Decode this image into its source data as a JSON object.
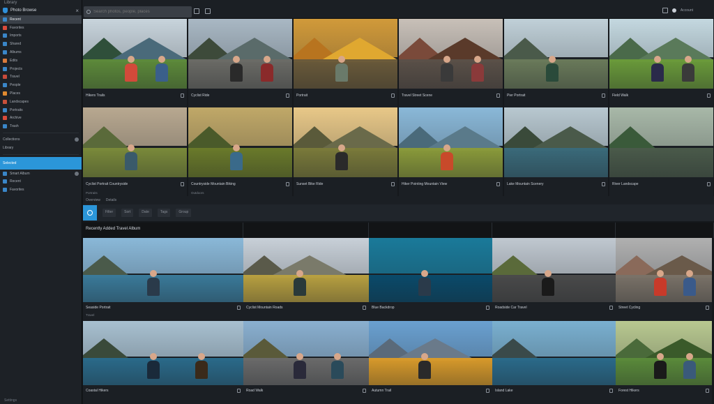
{
  "colors": {
    "accent": "#2b96d9",
    "sidebar_bg": "#1d2126",
    "panel_bg": "#1b1f24",
    "strip_bg": "#121416"
  },
  "sidebar": {
    "top_label": "Library",
    "header_title": "Photo Browse",
    "items": [
      {
        "label": "Recent",
        "icon": "folder-icon",
        "color": "#3a86c8",
        "selected": true
      },
      {
        "label": "Favorites",
        "icon": "star-icon",
        "color": "#d94b3b"
      },
      {
        "label": "Imports",
        "icon": "download-icon",
        "color": "#3a86c8"
      },
      {
        "label": "Shared",
        "icon": "share-icon",
        "color": "#3a86c8"
      },
      {
        "label": "Albums",
        "icon": "album-icon",
        "color": "#3a86c8"
      },
      {
        "label": "Edits",
        "icon": "edit-icon",
        "color": "#d97a3b"
      },
      {
        "label": "Projects",
        "icon": "folder-icon",
        "color": "#3a86c8"
      },
      {
        "label": "Travel",
        "icon": "folder-icon",
        "color": "#c84a3a"
      },
      {
        "label": "People",
        "icon": "person-icon",
        "color": "#3a86c8"
      },
      {
        "label": "Places",
        "icon": "pin-icon",
        "color": "#e08a30"
      },
      {
        "label": "Landscapes",
        "icon": "image-icon",
        "color": "#c8503a"
      },
      {
        "label": "Portraits",
        "icon": "image-icon",
        "color": "#3a86c8"
      },
      {
        "label": "Archive",
        "icon": "archive-icon",
        "color": "#d94b3b"
      },
      {
        "label": "Trash",
        "icon": "trash-icon",
        "color": "#3a86c8"
      }
    ],
    "groups_label": "Collections",
    "sub_label": "Library",
    "active_item": "Selected",
    "sub_items": [
      "Smart Album",
      "Recent",
      "Favorites"
    ],
    "bottom_label": "Settings"
  },
  "topbar": {
    "search_placeholder": "Search photos, people, places",
    "profile_label": "Account"
  },
  "top_grid": [
    {
      "title": "Hikers Trails",
      "sub": "",
      "scene": "hikers"
    },
    {
      "title": "Cyclist Ride",
      "sub": "",
      "scene": "cyclist-road"
    },
    {
      "title": "Portrait",
      "sub": "",
      "scene": "autumn-portrait"
    },
    {
      "title": "Travel Street Scene",
      "sub": "",
      "scene": "street"
    },
    {
      "title": "Pier Portrait",
      "sub": "",
      "scene": "pier"
    },
    {
      "title": "Field Walk",
      "sub": "",
      "scene": "field"
    },
    {
      "title": "Cyclist Portrait Countryside",
      "sub": "Portraits",
      "scene": "helmet-portrait"
    },
    {
      "title": "Countryside Mountain Biking",
      "sub": "Outdoors",
      "scene": "mtb"
    },
    {
      "title": "Sunset Bike Ride",
      "sub": "",
      "scene": "sunset-bike"
    },
    {
      "title": "Hiker Pointing Mountain View",
      "sub": "",
      "scene": "pointing"
    },
    {
      "title": "Lake Mountain Scenery",
      "sub": "",
      "scene": "lake"
    },
    {
      "title": "River Landscape",
      "sub": "",
      "scene": "river"
    }
  ],
  "tabs": [
    "Overview",
    "Details"
  ],
  "toolbar_chips": [
    "Filter",
    "Sort",
    "Date",
    "Tags",
    "Group"
  ],
  "strip_labels": [
    "Recently Added Travel Album",
    "",
    "",
    "",
    ""
  ],
  "bottom_grid": [
    {
      "title": "Seaside Portrait",
      "sub": "Travel",
      "scene": "coast-man"
    },
    {
      "title": "Cyclist Mountain Roads",
      "sub": "",
      "scene": "cyclist-mtn"
    },
    {
      "title": "Blue Backdrop",
      "sub": "",
      "scene": "blue"
    },
    {
      "title": "Roadside Car Travel",
      "sub": "",
      "scene": "car"
    },
    {
      "title": "Street Cycling",
      "sub": "",
      "scene": "city-bike"
    },
    {
      "title": "Coastal Hikers",
      "sub": "",
      "scene": "coast-pair"
    },
    {
      "title": "Road Walk",
      "sub": "",
      "scene": "road-pair"
    },
    {
      "title": "Autumn Trail",
      "sub": "",
      "scene": "trail"
    },
    {
      "title": "Island Lake",
      "sub": "",
      "scene": "island"
    },
    {
      "title": "Forest Hikers",
      "sub": "",
      "scene": "forest"
    }
  ]
}
